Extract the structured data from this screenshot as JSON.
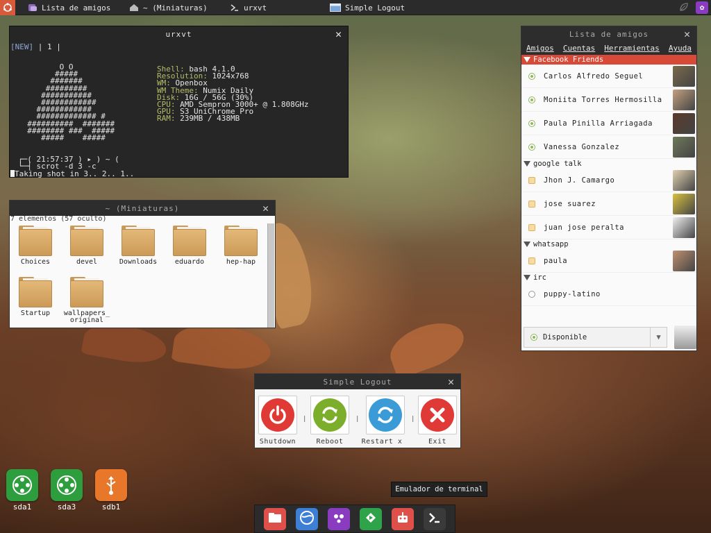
{
  "panel": {
    "tasks": [
      {
        "label": "Lista de amigos",
        "icon": "pidgin-icon"
      },
      {
        "label": "~ (Miniaturas)",
        "icon": "home-folder-icon"
      },
      {
        "label": "urxvt",
        "icon": "terminal-icon"
      },
      {
        "label": "Simple Logout",
        "icon": "window-icon"
      }
    ]
  },
  "urxvt": {
    "title": "urxvt",
    "tag_new": "[NEW]",
    "tag_sep": " | 1 |",
    "art": [
      "         O O",
      "        #####",
      "       #######",
      "      #########",
      "     ###########",
      "     ############",
      "    ############",
      "    ############# #",
      "  ##########  #######",
      "  ######## ###  #####",
      "     #####    #####"
    ],
    "info": [
      {
        "key": "Shell:",
        "value": "bash 4.1.0"
      },
      {
        "key": "Resolution:",
        "value": "1024x768"
      },
      {
        "key": "WM:",
        "value": "Openbox"
      },
      {
        "key": "WM Theme:",
        "value": "Numix Daily"
      },
      {
        "key": "Disk:",
        "value": "16G / 56G (30%)"
      },
      {
        "key": "CPU:",
        "value": "AMD Sempron 3000+ @ 1.808GHz"
      },
      {
        "key": "GPU:",
        "value": "S3 UniChrome Pro"
      },
      {
        "key": "RAM:",
        "value": "239MB / 438MB"
      }
    ],
    "prompt1": "┌─( 21:57:37 ) ▸ ) ~ (",
    "prompt2": "└─┤ scrot -d 3 -c",
    "output": "Taking shot in 3.. 2.. 1.."
  },
  "filemanager": {
    "title": "~ (Miniaturas)",
    "status": "7 elementos (57 oculto)",
    "folders": [
      "Choices",
      "devel",
      "Downloads",
      "eduardo",
      "hep-hap",
      "Startup",
      "wallpapers_\noriginal"
    ]
  },
  "buddylist": {
    "title": "Lista de amigos",
    "menu": [
      "Amigos",
      "Cuentas",
      "Herramientas",
      "Ayuda"
    ],
    "groups": [
      {
        "name": "Facebook Friends",
        "style": "fb",
        "buddies": [
          {
            "name": "Carlos Alfredo Seguel",
            "status": "available"
          },
          {
            "name": "Moniita Torres Hermosilla",
            "status": "available"
          },
          {
            "name": "Paula Pinilla Arriagada",
            "status": "available"
          },
          {
            "name": "Vanessa Gonzalez",
            "status": "available"
          }
        ]
      },
      {
        "name": "google talk",
        "style": "plain",
        "buddies": [
          {
            "name": "Jhon J. Camargo",
            "status": "away"
          },
          {
            "name": "jose suarez",
            "status": "away"
          },
          {
            "name": "juan jose peralta",
            "status": "away"
          }
        ]
      },
      {
        "name": "whatsapp",
        "style": "plain",
        "buddies": [
          {
            "name": "paula",
            "status": "away"
          }
        ]
      },
      {
        "name": "irc",
        "style": "plain",
        "buddies": [
          {
            "name": "puppy-latino",
            "status": "idle"
          }
        ]
      }
    ],
    "status_value": "Disponible"
  },
  "logout": {
    "title": "Simple Logout",
    "buttons": [
      {
        "label": "Shutdown",
        "color": "#e03a36"
      },
      {
        "label": "Reboot",
        "color": "#7cae2c"
      },
      {
        "label": "Restart x",
        "color": "#3b9bd6"
      },
      {
        "label": "Exit",
        "color": "#e03a36"
      }
    ],
    "separator": "|"
  },
  "desktop": {
    "icons": [
      {
        "label": "sda1",
        "color": "#2e9d3e"
      },
      {
        "label": "sda3",
        "color": "#2e9d3e"
      },
      {
        "label": "sdb1",
        "color": "#e8772a"
      }
    ]
  },
  "tooltip": "Emulador de terminal",
  "dock": {
    "items": [
      {
        "name": "file-manager",
        "color": "#e0504a"
      },
      {
        "name": "web-browser",
        "color": "#3c7fd4"
      },
      {
        "name": "pidgin",
        "color": "#8a3cc0"
      },
      {
        "name": "media-player",
        "color": "#2ea34a"
      },
      {
        "name": "software-installer",
        "color": "#e0504a"
      },
      {
        "name": "terminal",
        "color": "#3a3a3a"
      }
    ]
  }
}
